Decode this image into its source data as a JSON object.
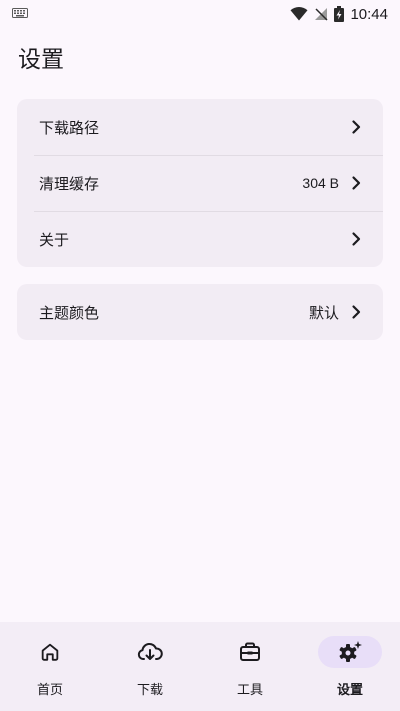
{
  "status_bar": {
    "time": "10:44",
    "icons": [
      "keyboard-icon",
      "wifi-icon",
      "no-signal-icon",
      "battery-charging-icon"
    ]
  },
  "page": {
    "title": "设置"
  },
  "settings_group_1": [
    {
      "label": "下载路径",
      "value": ""
    },
    {
      "label": "清理缓存",
      "value": "304 B"
    },
    {
      "label": "关于",
      "value": ""
    }
  ],
  "settings_group_2": [
    {
      "label": "主题颜色",
      "value": "默认"
    }
  ],
  "bottom_nav": {
    "items": [
      {
        "label": "首页",
        "icon": "home-icon"
      },
      {
        "label": "下载",
        "icon": "cloud-download-icon"
      },
      {
        "label": "工具",
        "icon": "toolbox-icon"
      },
      {
        "label": "设置",
        "icon": "settings-icon"
      }
    ],
    "active": "设置",
    "active_color": "#e8def8"
  },
  "colors": {
    "background": "#fcf7fd",
    "card": "#f2ecf4",
    "nav": "#f3edf6",
    "text": "#1c1b1f"
  }
}
